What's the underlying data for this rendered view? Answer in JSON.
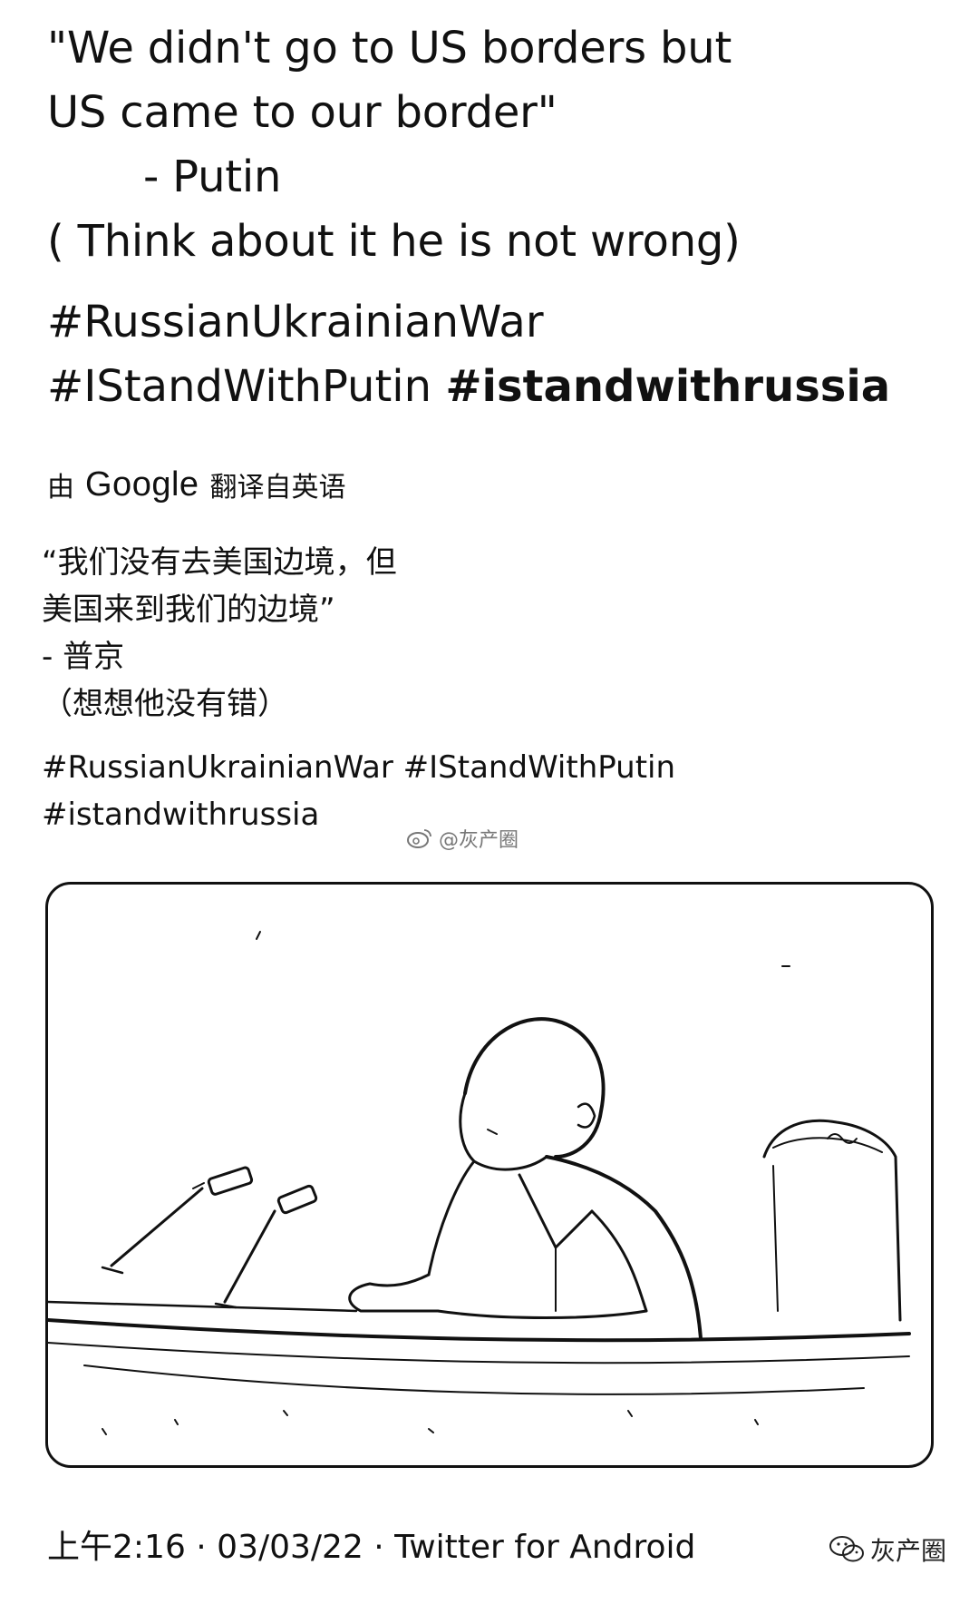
{
  "tweet": {
    "text_lines": [
      "\"We didn't go to US borders but",
      "US came to our border\"",
      "- Putin",
      "( Think about it he is not wrong)"
    ],
    "hashtags_line1": "#RussianUkrainianWar",
    "hashtags_line2_a": "#IStandWithPutin",
    "hashtags_line2_b": "#istandwithrussia"
  },
  "translation": {
    "prefix": "由",
    "google": "Google",
    "suffix": "翻译自英语",
    "lines": [
      "“我们没有去美国边境，但",
      "美国来到我们的边境”",
      "- 普京",
      "（想想他没有错）"
    ],
    "tags_line1": "#RussianUkrainianWar #IStandWithPutin",
    "tags_line2": "#istandwithrussia"
  },
  "watermark": {
    "weibo": "@灰产圈"
  },
  "footer": {
    "meta": "上午2:16 · 03/03/22 · Twitter for Android"
  },
  "wechat_mark": {
    "label": "灰产圈",
    "icon": "wechat-icon"
  },
  "photo": {
    "icon": "photo"
  }
}
